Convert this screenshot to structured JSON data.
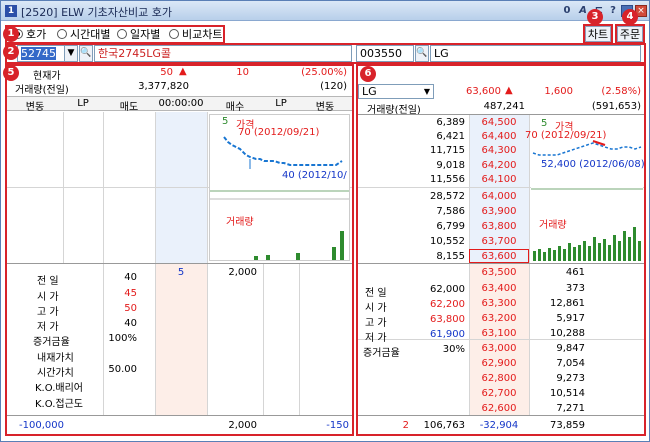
{
  "window": {
    "title": "[2520] ELW 기초자산비교 호가",
    "icon": "1",
    "controls": [
      "0",
      "A",
      "?"
    ]
  },
  "badges": [
    "1",
    "2",
    "3",
    "4",
    "5",
    "6"
  ],
  "radios": [
    {
      "label": "호가",
      "checked": true
    },
    {
      "label": "시간대별",
      "checked": false
    },
    {
      "label": "일자별",
      "checked": false
    },
    {
      "label": "비교차트",
      "checked": false
    }
  ],
  "buttons": {
    "chart": "차트",
    "order": "주문"
  },
  "inputs": {
    "elw_code": "52745",
    "elw_name": "한국2745LG콜",
    "stock_code": "003550",
    "stock_name": "LG"
  },
  "elw": {
    "price_label": "현재가",
    "price": "50",
    "change": "10",
    "change_pct": "(25.00%)",
    "volume_label": "거래량(전일)",
    "volume": "3,377,820",
    "volume_prev": "(120)",
    "headers": [
      "변동",
      "LP",
      "매도",
      "00:00:00",
      "매수",
      "LP",
      "변동"
    ],
    "mini_chart": {
      "price_label": "가격",
      "volume_label": "거래량",
      "high_note": "70 (2012/09/21)",
      "low_note": "40 (2012/10/",
      "five": "5"
    },
    "stats": [
      {
        "k": "전    일",
        "v": "40",
        "col": "black"
      },
      {
        "k": "시    가",
        "v": "45",
        "col": "red"
      },
      {
        "k": "고    가",
        "v": "50",
        "col": "red"
      },
      {
        "k": "저    가",
        "v": "40",
        "col": "black"
      },
      {
        "k": "증거금율",
        "v": "100%",
        "col": "black"
      },
      {
        "k": "내재가치",
        "v": "",
        "col": "black"
      },
      {
        "k": "시간가치",
        "v": "50.00",
        "col": "black"
      },
      {
        "k": "K.O.배리어",
        "v": "",
        "col": "black"
      },
      {
        "k": "K.O.접근도",
        "v": "",
        "col": "black"
      }
    ],
    "bid_count": "5",
    "bid_qty": "2,000",
    "footer": {
      "sell_change": "-100,000",
      "buy_total": "2,000",
      "buy_change": "-150"
    }
  },
  "stock": {
    "name": "LG",
    "price": "63,600",
    "change": "1,600",
    "change_pct": "(2.58%)",
    "volume_label": "거래량(전일)",
    "volume": "487,241",
    "volume_prev": "(591,653)",
    "asks": [
      {
        "q": "6,389",
        "p": "64,500"
      },
      {
        "q": "6,421",
        "p": "64,400"
      },
      {
        "q": "11,715",
        "p": "64,300"
      },
      {
        "q": "9,018",
        "p": "64,200"
      },
      {
        "q": "11,556",
        "p": "64,100"
      },
      {
        "q": "28,572",
        "p": "64,000"
      },
      {
        "q": "7,586",
        "p": "63,900"
      },
      {
        "q": "6,799",
        "p": "63,800"
      },
      {
        "q": "10,552",
        "p": "63,700"
      },
      {
        "q": "8,155",
        "p": "63,600"
      }
    ],
    "bids": [
      {
        "p": "63,500",
        "q": "461"
      },
      {
        "p": "63,400",
        "q": "373"
      },
      {
        "p": "63,300",
        "q": "12,861"
      },
      {
        "p": "63,200",
        "q": "5,917"
      },
      {
        "p": "63,100",
        "q": "10,288"
      },
      {
        "p": "63,000",
        "q": "9,847"
      },
      {
        "p": "62,900",
        "q": "7,054"
      },
      {
        "p": "62,800",
        "q": "9,273"
      },
      {
        "p": "62,700",
        "q": "10,514"
      },
      {
        "p": "62,600",
        "q": "7,271"
      }
    ],
    "stats": [
      {
        "k": "전    일",
        "v": "62,000",
        "col": "black"
      },
      {
        "k": "시    가",
        "v": "62,200",
        "col": "red"
      },
      {
        "k": "고    가",
        "v": "63,800",
        "col": "red"
      },
      {
        "k": "저    가",
        "v": "61,900",
        "col": "blue"
      },
      {
        "k": "증거금율",
        "v": "30%",
        "col": "black"
      }
    ],
    "mini_chart": {
      "price_label": "가격",
      "volume_label": "거래량",
      "high_note": "70 (2012/09/21)",
      "low_note": "52,400 (2012/06/08)",
      "five": "5"
    },
    "footer": {
      "count": "2",
      "ask_total": "106,763",
      "diff": "-32,904",
      "bid_total": "73,859"
    }
  }
}
